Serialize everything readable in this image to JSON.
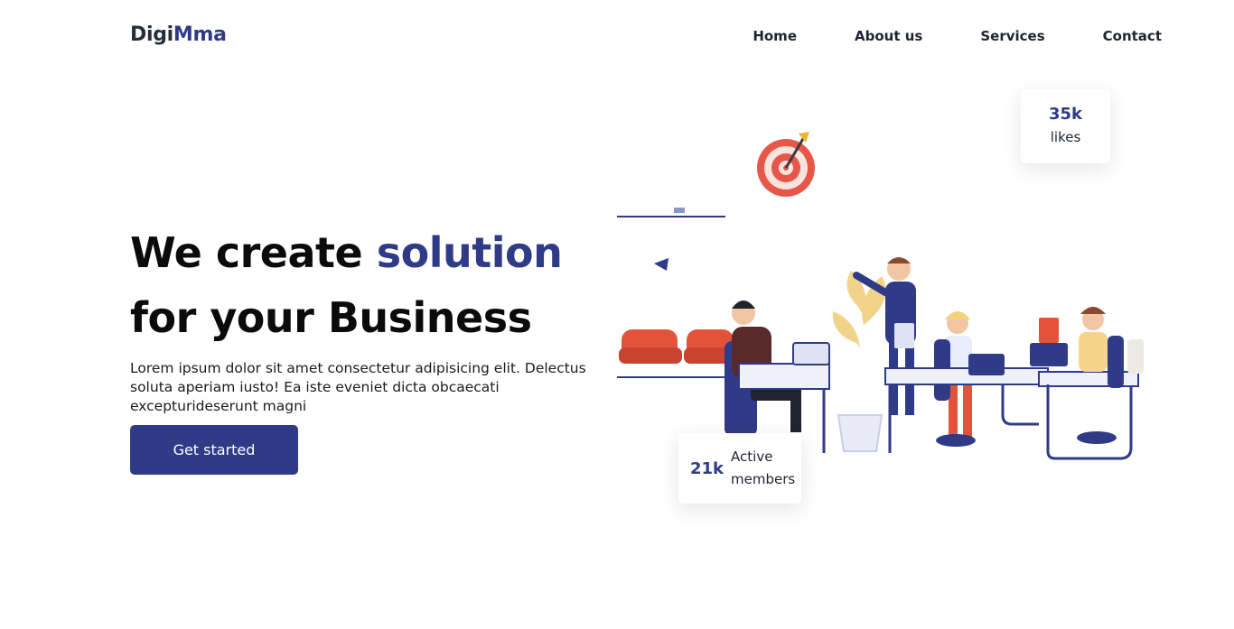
{
  "brand": {
    "part1": "Digi",
    "part2": "Mma"
  },
  "nav": {
    "items": [
      "Home",
      "About us",
      "Services",
      "Contact"
    ]
  },
  "hero": {
    "title_part1": "We create ",
    "title_accent": "solution",
    "title_line2": "for your Business",
    "description": "Lorem ipsum dolor sit amet consectetur adipisicing elit. Delectus soluta aperiam iusto! Ea iste eveniet dicta obcaecati excepturideserunt magni",
    "cta_label": "Get started"
  },
  "stats": {
    "likes": {
      "value": "35k",
      "label": "likes"
    },
    "members": {
      "value": "21k",
      "label": "Active members"
    }
  },
  "colors": {
    "accent": "#2f3b86",
    "text": "#0b0b0b",
    "chair": "#e2533a",
    "plant": "#f2d38a"
  },
  "icons": [
    "target-icon",
    "office-illustration"
  ]
}
